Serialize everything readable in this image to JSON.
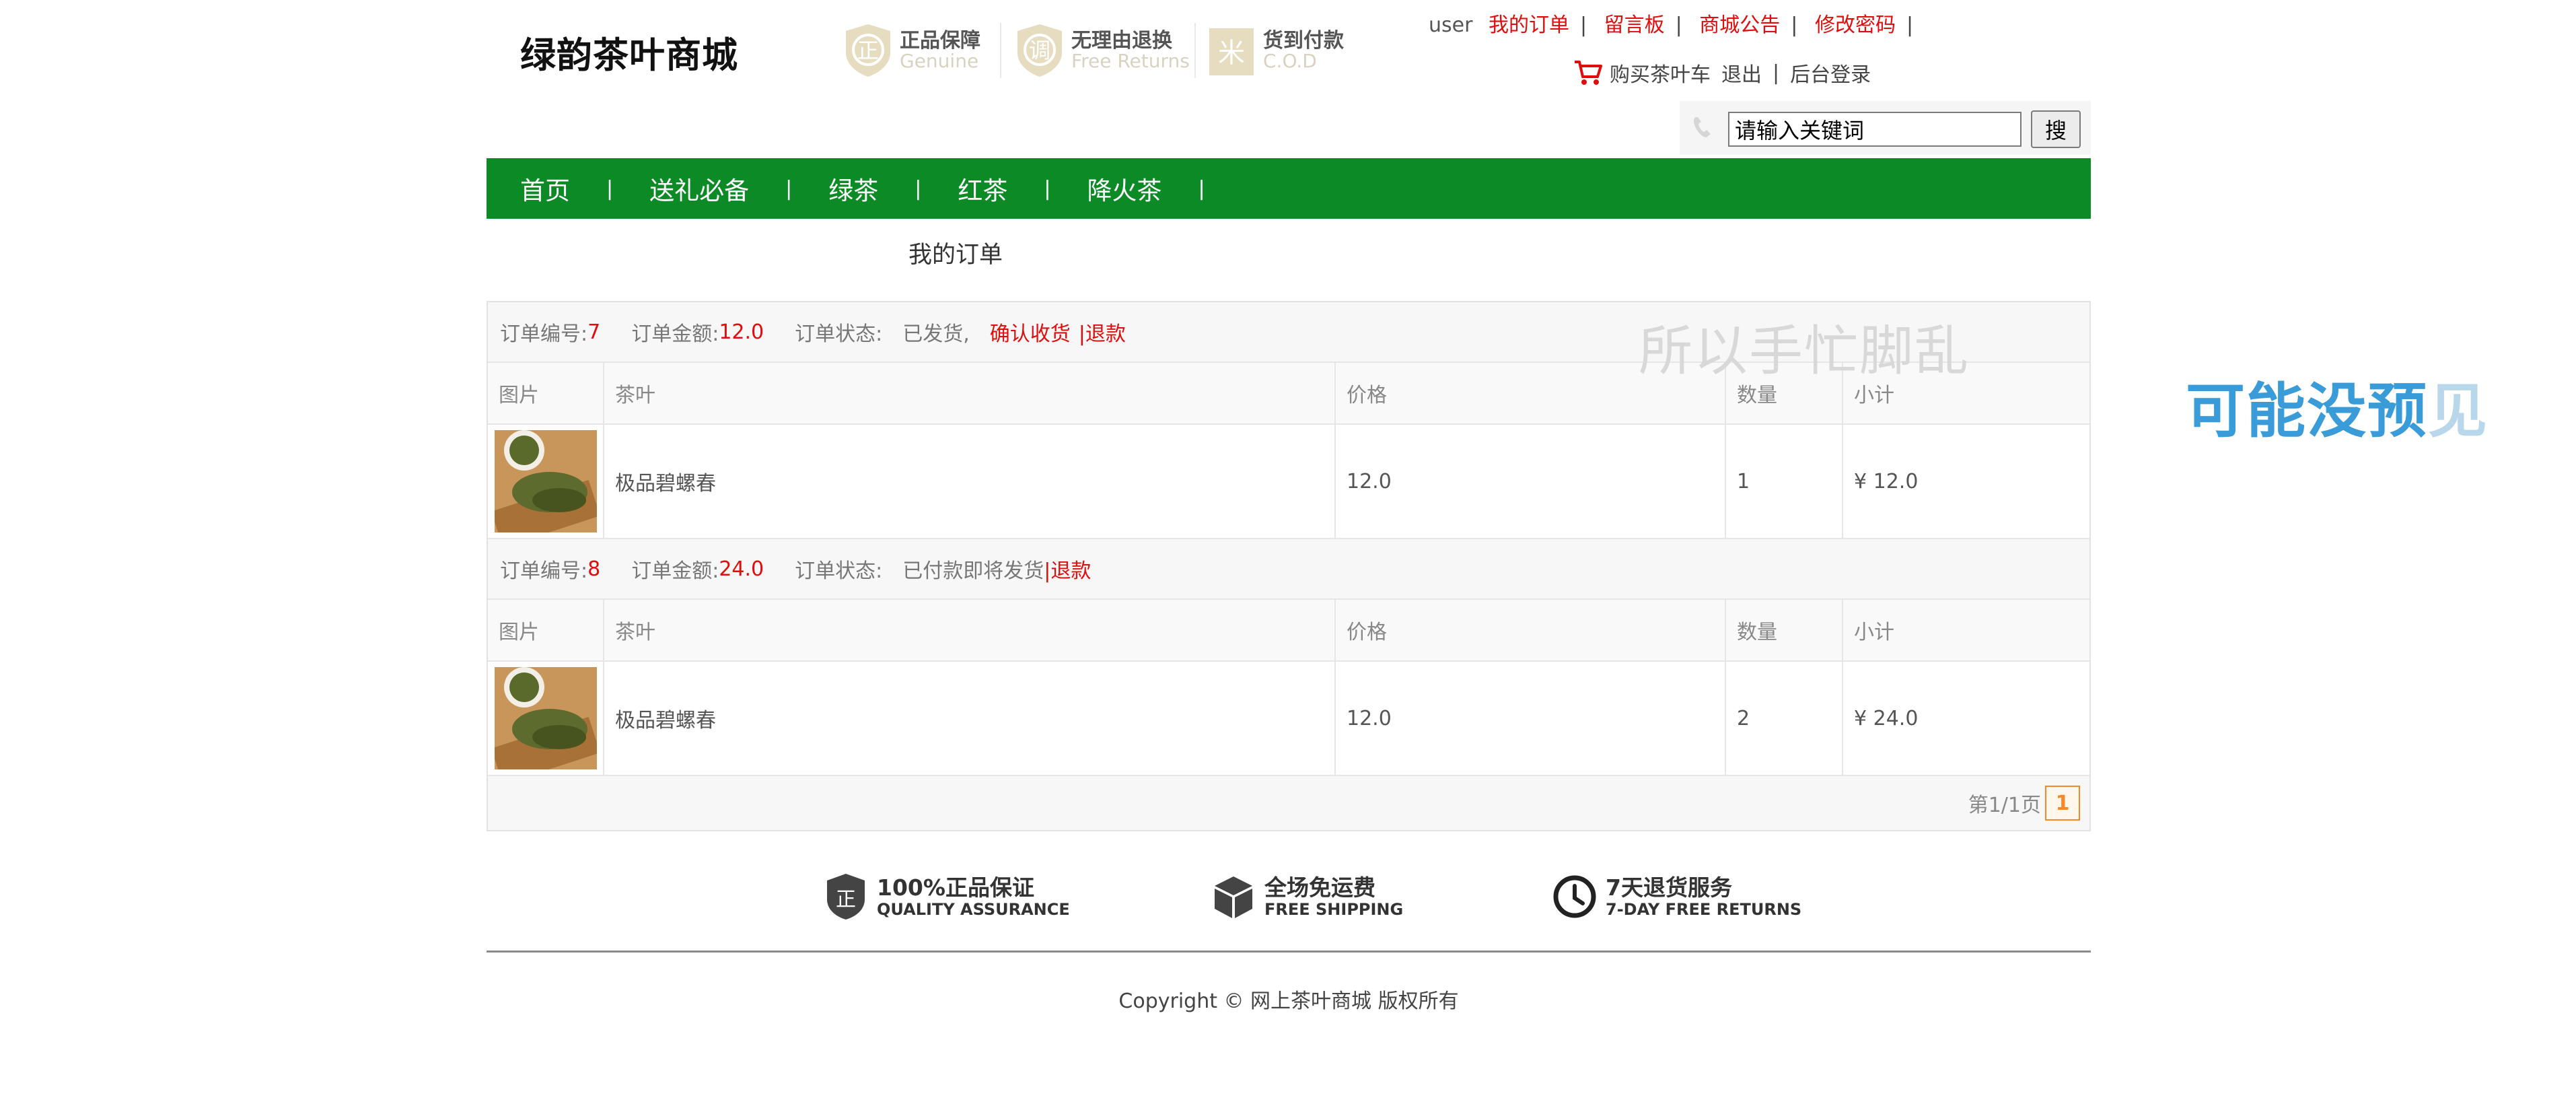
{
  "header": {
    "logo": "绿韵茶叶商城",
    "promises": [
      {
        "cn": "正品保障",
        "en": "Genuine",
        "glyph": "正"
      },
      {
        "cn": "无理由退换",
        "en": "Free Returns",
        "glyph": "调"
      },
      {
        "cn": "货到付款",
        "en": "C.O.D",
        "glyph": "米"
      }
    ],
    "user": "user",
    "links": [
      "我的订单",
      "留言板",
      "商城公告",
      "修改密码"
    ],
    "cart": "购买茶叶车",
    "logout": "退出",
    "admin": "后台登录",
    "search": {
      "value": "请输入关键词",
      "button": "搜"
    }
  },
  "nav": [
    "首页",
    "送礼必备",
    "绿茶",
    "红茶",
    "降火茶"
  ],
  "page_title": "我的订单",
  "overlay_text": "所以手忙脚乱",
  "side_text": {
    "main": "可能没预",
    "fade": "见"
  },
  "orders": {
    "labels": {
      "no": "订单编号:",
      "amount": "订单金额:",
      "status": "订单状态:"
    },
    "columns": [
      "图片",
      "茶叶",
      "价格",
      "数量",
      "小计"
    ],
    "list": [
      {
        "no": "7",
        "amount": "12.0",
        "status": "已发货,",
        "confirm": "确认收货",
        "refund": "|退款",
        "item": {
          "name": "极品碧螺春",
          "price": "12.0",
          "qty": "1",
          "subtotal": "¥ 12.0"
        }
      },
      {
        "no": "8",
        "amount": "24.0",
        "status": "已付款即将发货",
        "confirm": "",
        "refund": "|退款",
        "item": {
          "name": "极品碧螺春",
          "price": "12.0",
          "qty": "2",
          "subtotal": "¥ 24.0"
        }
      }
    ],
    "pager": {
      "text": "第1/1页",
      "current": "1"
    }
  },
  "services": [
    {
      "cn": "100%正品保证",
      "en": "QUALITY ASSURANCE",
      "icon": "shield-icon"
    },
    {
      "cn": "全场免运费",
      "en": "FREE SHIPPING",
      "icon": "box-icon"
    },
    {
      "cn": "7天退货服务",
      "en": "7-DAY FREE RETURNS",
      "icon": "clock-icon"
    }
  ],
  "copyright": "Copyright © 网上茶叶商城 版权所有",
  "colors": {
    "brand_green": "#0c8a26",
    "link_red": "#e00d0d",
    "pager_orange": "#f08a2c",
    "side_blue": "#3a9bd9"
  }
}
